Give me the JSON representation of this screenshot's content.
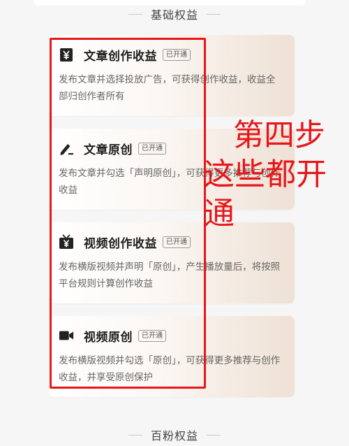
{
  "sections": {
    "basic": "基础权益",
    "hundred_fans": "百粉权益"
  },
  "cards": [
    {
      "icon": "yen-document-icon",
      "title": "文章创作收益",
      "badge": "已开通",
      "desc": "发布文章并选择投放广告，可获得创作收益，收益全部归创作者所有"
    },
    {
      "icon": "pen-icon",
      "title": "文章原创",
      "badge": "已开通",
      "desc": "发布文章并勾选「声明原创」，可获得更多推荐与创作收益"
    },
    {
      "icon": "yen-tv-icon",
      "title": "视频创作收益",
      "badge": "已开通",
      "desc": "发布横版视频并声明「原创」，产生播放量后，将按照平台规则计算创作收益"
    },
    {
      "icon": "video-camera-icon",
      "title": "视频原创",
      "badge": "已开通",
      "desc": "发布横版视频并勾选「原创」，可获得更多推荐与创作收益，并享受原创保护"
    }
  ],
  "annotation": {
    "line1": "第四步",
    "line2": "这些都开",
    "line3": "通"
  },
  "colors": {
    "annotation_red": "#e8161a",
    "card_gradient_end": "#eee1d5"
  }
}
